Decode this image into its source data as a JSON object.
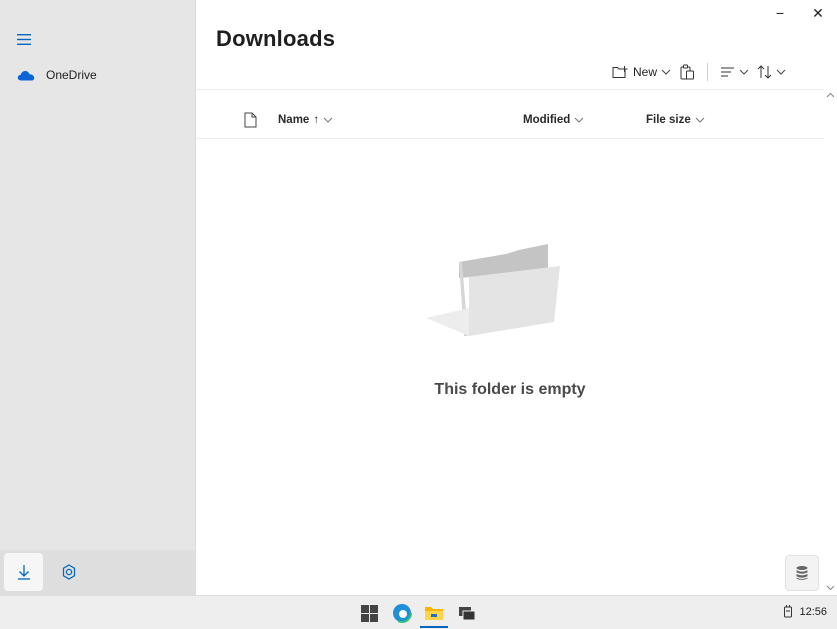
{
  "sidebar": {
    "menu_icon": "hamburger-icon",
    "items": [
      {
        "label": "OneDrive",
        "icon": "onedrive-cloud-icon"
      }
    ],
    "bottom": {
      "downloads_icon": "download-arrow-icon",
      "settings_icon": "gear-icon"
    }
  },
  "window": {
    "minimize": "−",
    "close": "✕"
  },
  "main": {
    "title": "Downloads",
    "toolbar": {
      "new_label": "New"
    },
    "columns": {
      "name": "Name",
      "name_sort": "↑",
      "modified": "Modified",
      "file_size": "File size"
    },
    "empty_message": "This folder is empty"
  },
  "taskbar": {
    "clock": "12:56"
  },
  "colors": {
    "accent": "#0078d4",
    "sidebar_bg": "#e6e6e6",
    "taskbar_bg": "#eeeeee"
  }
}
